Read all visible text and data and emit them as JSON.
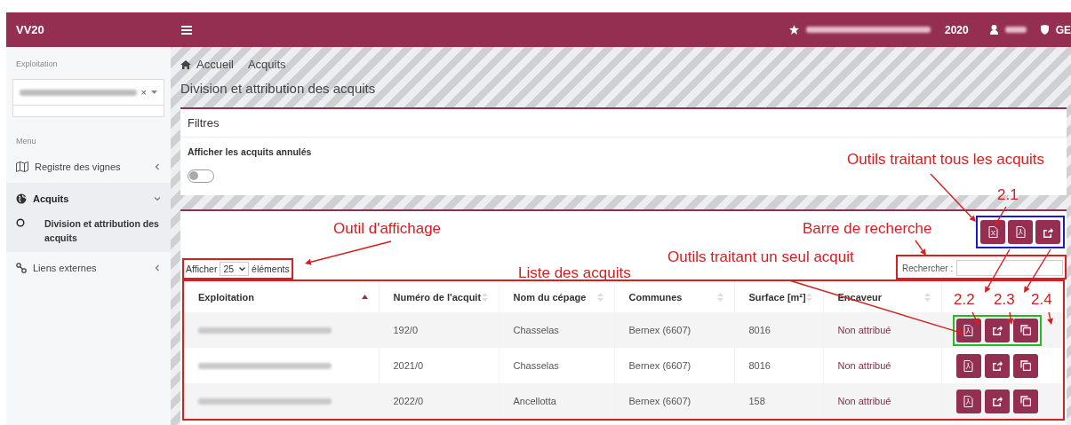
{
  "header": {
    "logo": "VV20",
    "year": "2020",
    "role": "GE"
  },
  "sidebar": {
    "exploitation_label": "Exploitation",
    "select_clear": "×",
    "menu_label": "Menu",
    "items": [
      {
        "label": "Registre des vignes",
        "selected": false,
        "expanded": false
      },
      {
        "label": "Acquits",
        "selected": true,
        "expanded": true,
        "children": [
          {
            "label": "Division et attribution des acquits",
            "selected": true
          }
        ]
      },
      {
        "label": "Liens externes",
        "selected": false,
        "expanded": false
      }
    ]
  },
  "breadcrumb": [
    "Accueil",
    "Acquits"
  ],
  "page_title": "Division et attribution des acquits",
  "filters": {
    "title": "Filtres",
    "toggle_label": "Afficher les acquits annulés",
    "toggle_on": false
  },
  "length": {
    "prefix": "Afficher",
    "value": "25",
    "suffix": "éléments"
  },
  "search": {
    "label": "Rechercher :"
  },
  "table": {
    "columns": [
      {
        "label": "Exploitation",
        "sorted": true
      },
      {
        "label": "Numéro de l'acquit",
        "sorted": false
      },
      {
        "label": "Nom du cépage",
        "sorted": false
      },
      {
        "label": "Communes",
        "sorted": false
      },
      {
        "label": "Surface [m²]",
        "sorted": false
      },
      {
        "label": "Encaveur",
        "sorted": false
      }
    ],
    "rows": [
      {
        "numero": "192/0",
        "cepage": "Chasselas",
        "commune": "Bernex (6607)",
        "surface": "8016",
        "encaveur": "Non attribué",
        "highlighted": true
      },
      {
        "numero": "2021/0",
        "cepage": "Chasselas",
        "commune": "Bernex (6607)",
        "surface": "8016",
        "encaveur": "Non attribué",
        "highlighted": false
      },
      {
        "numero": "2022/0",
        "cepage": "Ancellotta",
        "commune": "Bernex (6607)",
        "surface": "158",
        "encaveur": "Non attribué",
        "highlighted": false
      }
    ]
  },
  "annotations": [
    {
      "text": "Outils traitant tous les acquits"
    },
    {
      "text": "2.1"
    },
    {
      "text": "Outil d'affichage"
    },
    {
      "text": "Barre de recherche"
    },
    {
      "text": "Outils traitant un seul acquit"
    },
    {
      "text": "Liste des acquits"
    },
    {
      "text": "2.2"
    },
    {
      "text": "2.3"
    },
    {
      "text": "2.4"
    }
  ]
}
